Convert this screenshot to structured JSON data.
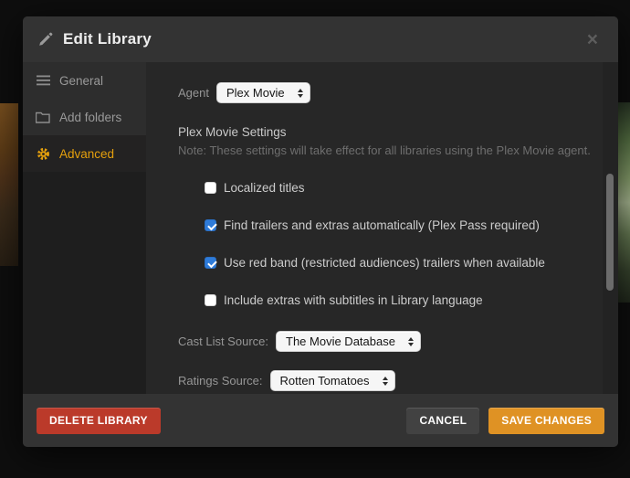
{
  "dialog": {
    "title": "Edit Library",
    "close_glyph": "×"
  },
  "sidebar": {
    "items": [
      {
        "label": "General",
        "icon": "list-icon",
        "selected": false
      },
      {
        "label": "Add folders",
        "icon": "folder-icon",
        "selected": false
      },
      {
        "label": "Advanced",
        "icon": "gear-icon",
        "selected": true
      }
    ]
  },
  "content": {
    "agent": {
      "label": "Agent",
      "value": "Plex Movie"
    },
    "section": {
      "heading": "Plex Movie Settings",
      "note": "Note: These settings will take effect for all libraries using the Plex Movie agent."
    },
    "checkboxes": [
      {
        "label": "Localized titles",
        "checked": false
      },
      {
        "label": "Find trailers and extras automatically (Plex Pass required)",
        "checked": true
      },
      {
        "label": "Use red band (restricted audiences) trailers when available",
        "checked": true
      },
      {
        "label": "Include extras with subtitles in Library language",
        "checked": false
      }
    ],
    "cast_list_source": {
      "label": "Cast List Source:",
      "value": "The Movie Database"
    },
    "ratings_source": {
      "label": "Ratings Source:",
      "value": "Rotten Tomatoes"
    }
  },
  "footer": {
    "delete_label": "DELETE LIBRARY",
    "cancel_label": "CANCEL",
    "save_label": "SAVE CHANGES"
  },
  "colors": {
    "accent_orange": "#e5a00d",
    "save_orange": "#df9224",
    "delete_red": "#bb3a2a",
    "checkbox_blue": "#2e7bd9",
    "header_bg": "#333333",
    "content_bg": "#272727"
  }
}
